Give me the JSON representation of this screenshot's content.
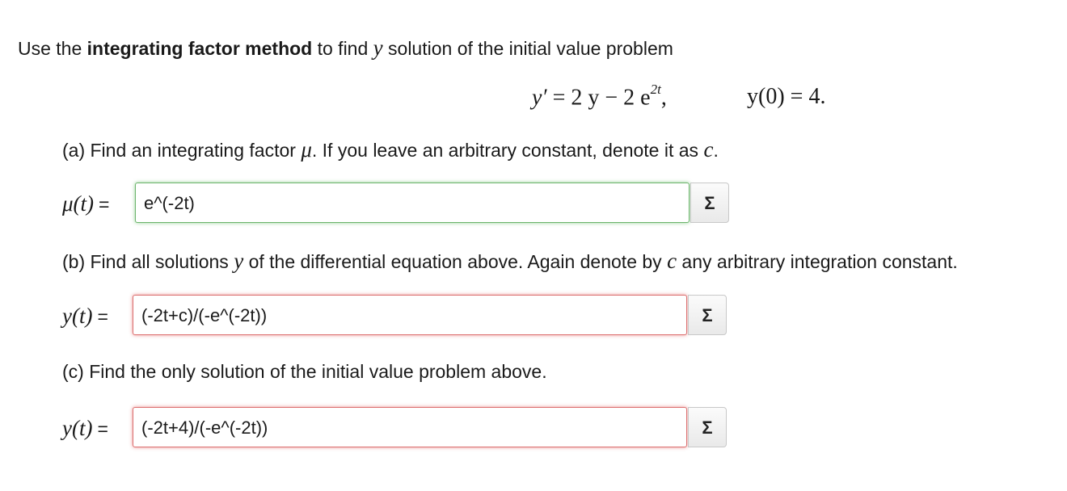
{
  "intro": {
    "prefix": "Use the ",
    "bold": "integrating factor method",
    "middle": " to find ",
    "var": "y",
    "suffix": " solution of the initial value problem"
  },
  "equation": {
    "lhs": "y′",
    "rhs_text": " = 2 y − 2 e",
    "exponent": "2t",
    "comma": ",",
    "initial_condition": "y(0) = 4."
  },
  "part_a": {
    "text1": "(a) Find an integrating factor ",
    "mu": "μ",
    "text2": ". If you leave an arbitrary constant, denote it as ",
    "c": "c",
    "text3": ".",
    "label": "μ(t)",
    "equals": "=",
    "answer": "e^(-2t)",
    "status": "correct"
  },
  "part_b": {
    "text1": "(b) Find all solutions ",
    "y": "y",
    "text2": " of the differential equation above. Again denote by ",
    "c": "c",
    "text3": " any arbitrary integration constant.",
    "label": "y(t)",
    "equals": "=",
    "answer": "(-2t+c)/(-e^(-2t))",
    "status": "incorrect"
  },
  "part_c": {
    "text": "(c) Find the only solution of the initial value problem above.",
    "label": "y(t)",
    "equals": "=",
    "answer": "(-2t+4)/(-e^(-2t))",
    "status": "incorrect"
  },
  "equation_editor": {
    "icon": "Σ"
  },
  "colors": {
    "correct": "#6cb46c",
    "incorrect": "#dc7070"
  }
}
